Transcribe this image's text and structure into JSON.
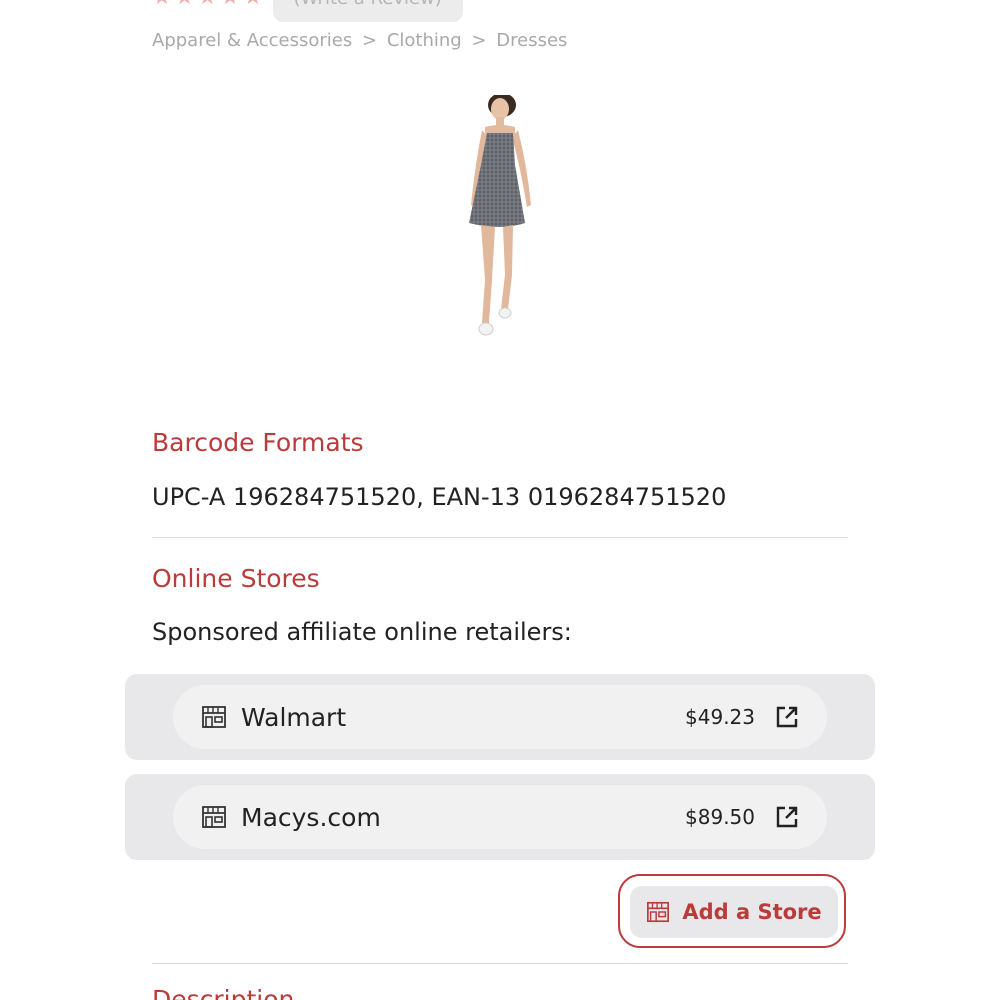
{
  "rating": {
    "stars": [
      "★",
      "★",
      "★",
      "★",
      "★"
    ],
    "write_review_label": "(Write a Review)"
  },
  "breadcrumb": {
    "items": [
      "Apparel & Accessories",
      "Clothing",
      "Dresses"
    ],
    "separator": ">"
  },
  "product": {
    "image_icon": "dress-photo"
  },
  "barcode": {
    "title": "Barcode Formats",
    "value": "UPC-A 196284751520, EAN-13 0196284751520"
  },
  "online_stores": {
    "title": "Online Stores",
    "subtitle": "Sponsored affiliate online retailers:",
    "stores": [
      {
        "name": "Walmart",
        "price": "$49.23",
        "icon": "store-icon",
        "link_icon": "external-link-icon"
      },
      {
        "name": "Macys.com",
        "price": "$89.50",
        "icon": "store-icon",
        "link_icon": "external-link-icon"
      }
    ],
    "add_store_label": "Add a Store"
  },
  "description": {
    "title": "Description"
  },
  "colors": {
    "accent": "#bb3a3a",
    "card_bg": "#e8e8ea",
    "muted_text": "#a9a9a9"
  }
}
